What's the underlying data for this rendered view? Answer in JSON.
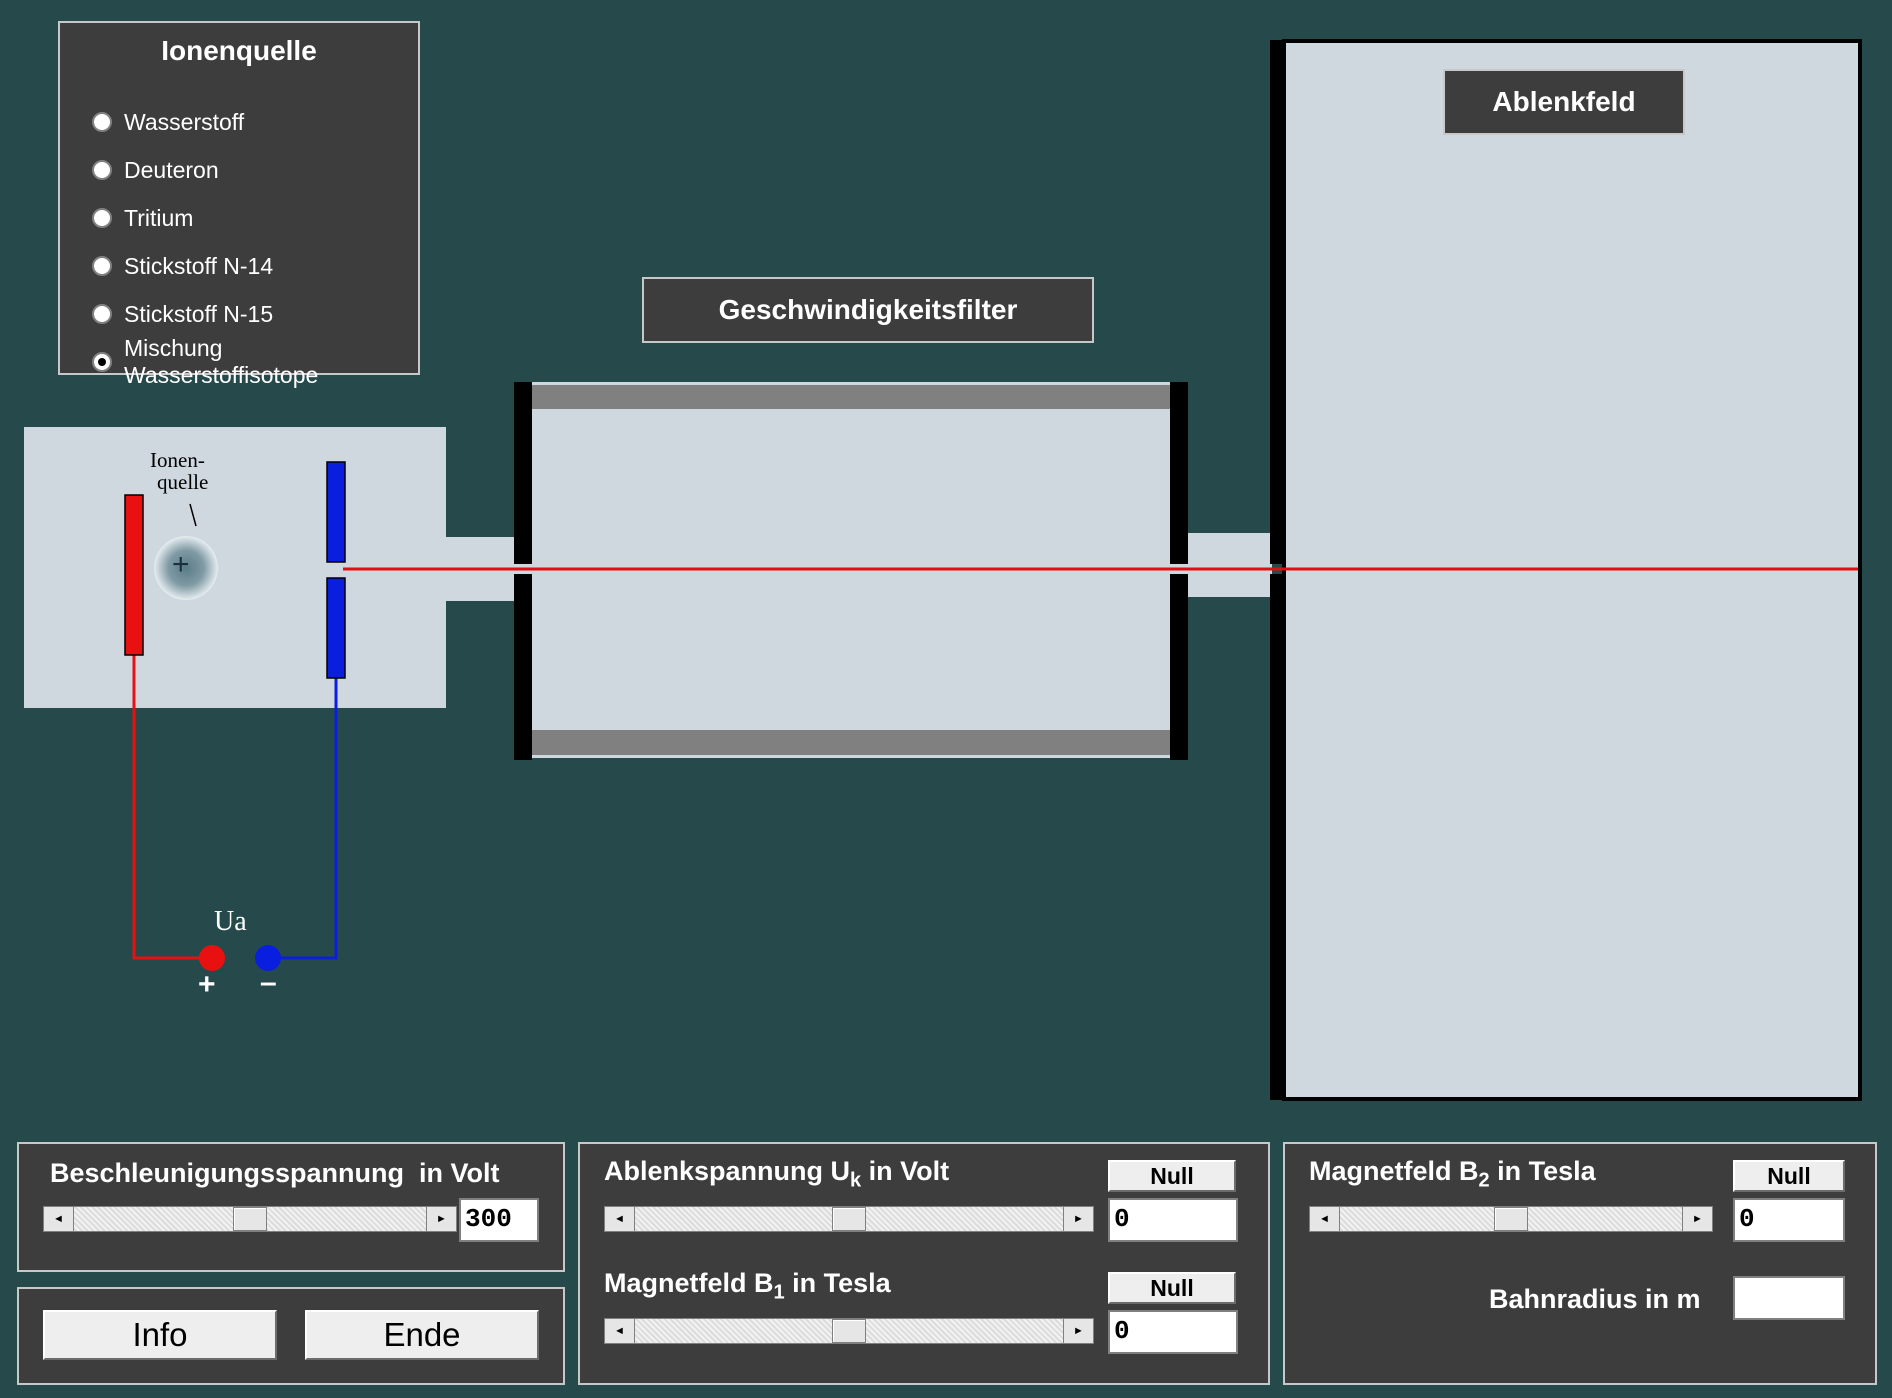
{
  "ion_source_panel": {
    "title": "Ionenquelle",
    "options": [
      {
        "label": "Wasserstoff",
        "checked": false
      },
      {
        "label": "Deuteron",
        "checked": false
      },
      {
        "label": "Tritium",
        "checked": false
      },
      {
        "label": "Stickstoff N-14",
        "checked": false
      },
      {
        "label": "Stickstoff N-15",
        "checked": false
      },
      {
        "label": "Mischung Wasserstoffisotope",
        "checked": true
      }
    ]
  },
  "apparatus": {
    "ion_source_label_line1": "Ionen-",
    "ion_source_label_line2": "quelle",
    "ion_source_pointer": "/",
    "ion_symbol": "+",
    "voltage_label": "Ua",
    "plus_sign": "+",
    "minus_sign": "–",
    "velocity_filter_label": "Geschwindigkeitsfilter",
    "deflection_field_label": "Ablenkfeld"
  },
  "controls": {
    "acceleration": {
      "label": "Beschleunigungsspannung  in Volt",
      "value": "300",
      "slider_fraction": 0.5
    },
    "deflection_voltage": {
      "label_pre": "Ablenkspannung U",
      "label_sub": "k",
      "label_post": " in Volt",
      "null_button": "Null",
      "value": "0",
      "slider_fraction": 0.5
    },
    "magnetic_b1": {
      "label_pre": "Magnetfeld B",
      "label_sub": "1",
      "label_post": " in Tesla",
      "null_button": "Null",
      "value": "0",
      "slider_fraction": 0.5
    },
    "magnetic_b2": {
      "label_pre": "Magnetfeld B",
      "label_sub": "2",
      "label_post": " in Tesla",
      "null_button": "Null",
      "value": "0",
      "slider_fraction": 0.5
    },
    "orbit_radius": {
      "label": "Bahnradius in m",
      "value": ""
    },
    "info_button": "Info",
    "end_button": "Ende"
  },
  "colors": {
    "background": "#264a4c",
    "chamber": "#cfd7df",
    "positive": "#e81010",
    "negative": "#0a1ee0",
    "beam": "#e01010"
  },
  "icons": {
    "scroll_left": "◄",
    "scroll_right": "►"
  }
}
